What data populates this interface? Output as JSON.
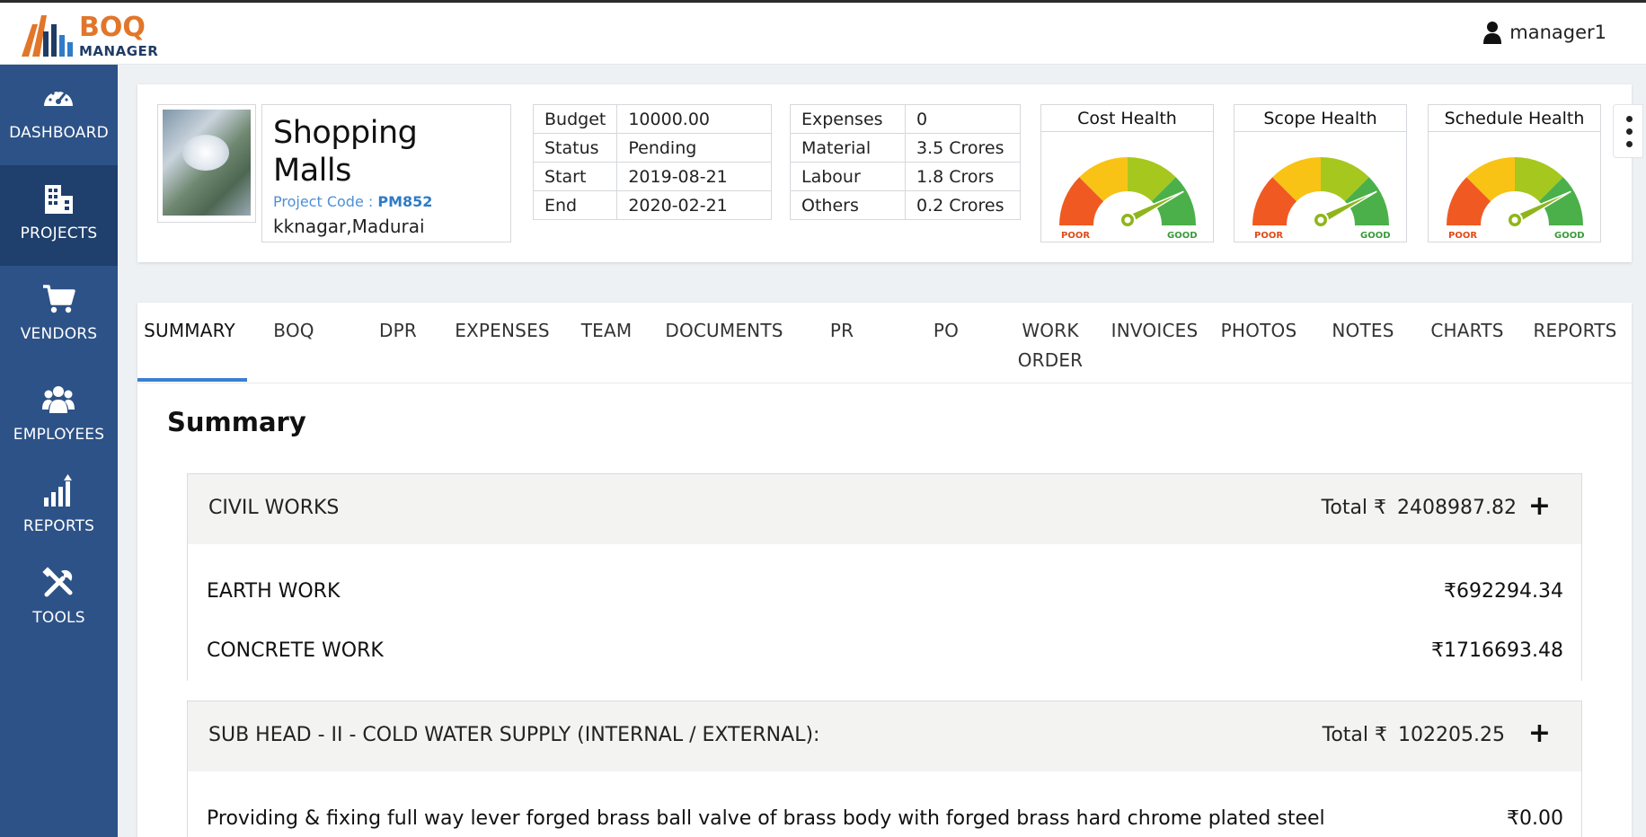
{
  "app": {
    "logo_top": "BOQ",
    "logo_bottom": "MANAGER",
    "user": "manager1"
  },
  "sidebar": {
    "items": [
      {
        "label": "DASHBOARD",
        "icon": "dashboard-gauge-icon"
      },
      {
        "label": "PROJECTS",
        "icon": "building-icon",
        "active": true
      },
      {
        "label": "VENDORS",
        "icon": "cart-icon"
      },
      {
        "label": "EMPLOYEES",
        "icon": "users-icon"
      },
      {
        "label": "REPORTS",
        "icon": "bar-chart-icon"
      },
      {
        "label": "TOOLS",
        "icon": "tools-icon"
      }
    ]
  },
  "project": {
    "name": "Shopping Malls",
    "code_label": "Project Code : ",
    "code": "PM852",
    "location": "kknagar,Madurai",
    "info": [
      {
        "label": "Budget",
        "value": "10000.00"
      },
      {
        "label": "Status",
        "value": "Pending"
      },
      {
        "label": "Start",
        "value": "2019-08-21"
      },
      {
        "label": "End",
        "value": "2020-02-21"
      }
    ],
    "costs": [
      {
        "label": "Expenses",
        "value": "0"
      },
      {
        "label": "Material",
        "value": "3.5 Crores"
      },
      {
        "label": "Labour",
        "value": "1.8 Crors"
      },
      {
        "label": "Others",
        "value": "0.2 Crores"
      }
    ],
    "gauges": [
      {
        "title": "Cost Health",
        "poor": "POOR",
        "good": "GOOD",
        "level": 0.85
      },
      {
        "title": "Scope Health",
        "poor": "POOR",
        "good": "GOOD",
        "level": 0.85
      },
      {
        "title": "Schedule Health",
        "poor": "POOR",
        "good": "GOOD",
        "level": 0.85
      }
    ]
  },
  "tabs": [
    {
      "label": "SUMMARY",
      "active": true
    },
    {
      "label": "BOQ"
    },
    {
      "label": "DPR"
    },
    {
      "label": "EXPENSES"
    },
    {
      "label": "TEAM"
    },
    {
      "label": "DOCUMENTS"
    },
    {
      "label": "PR"
    },
    {
      "label": "PO"
    },
    {
      "label": "WORK ORDER"
    },
    {
      "label": "INVOICES"
    },
    {
      "label": "PHOTOS"
    },
    {
      "label": "NOTES"
    },
    {
      "label": "CHARTS"
    },
    {
      "label": "REPORTS"
    }
  ],
  "summary": {
    "title": "Summary",
    "total_label": "Total ₹",
    "groups": [
      {
        "name": "CIVIL WORKS",
        "total": "2408987.82",
        "items": [
          {
            "name": "EARTH WORK",
            "value": "₹692294.34"
          },
          {
            "name": "CONCRETE WORK",
            "value": "₹1716693.48"
          }
        ]
      },
      {
        "name": "SUB HEAD - II - COLD WATER SUPPLY (INTERNAL / EXTERNAL):",
        "total": "102205.25",
        "items": [
          {
            "name": "Providing & fixing full way lever forged brass ball valve of brass body with forged brass hard chrome plated steel",
            "value": "₹0.00"
          }
        ]
      }
    ]
  },
  "colors": {
    "sidebar": "#2d5287",
    "sidebar_active": "#1f3f6c",
    "accent": "#3a7fd1",
    "logo_orange": "#e1762a",
    "logo_navy": "#1f3c66"
  }
}
